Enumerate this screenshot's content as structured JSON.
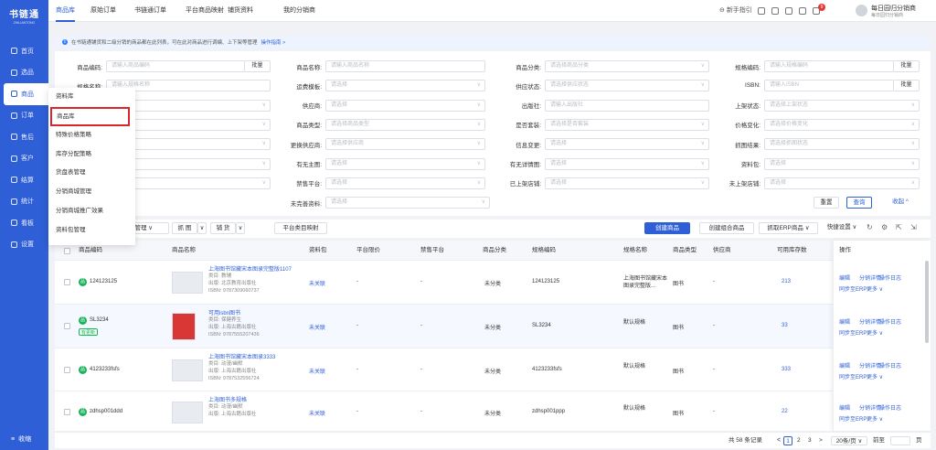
{
  "app": {
    "logo": "书链通",
    "logo_sub": "ZHILIANTONG"
  },
  "leftnav": [
    {
      "label": "首页",
      "icon": "home-icon"
    },
    {
      "label": "选品",
      "icon": "select-icon"
    },
    {
      "label": "商品",
      "icon": "goods-icon",
      "active": true
    },
    {
      "label": "订单",
      "icon": "order-icon"
    },
    {
      "label": "售后",
      "icon": "aftersale-icon"
    },
    {
      "label": "客户",
      "icon": "customer-icon"
    },
    {
      "label": "结算",
      "icon": "settle-icon"
    },
    {
      "label": "统计",
      "icon": "stats-icon"
    },
    {
      "label": "看板",
      "icon": "board-icon"
    },
    {
      "label": "设置",
      "icon": "settings-icon"
    }
  ],
  "leftnav_bottom": "收缩",
  "toptabs": [
    "商品库",
    "原始订单",
    "书链通订单",
    "平台商品映射",
    "铺货资料",
    "我的分销商"
  ],
  "topright": {
    "guide": "新手指引",
    "user": "每日园归分销商",
    "user_sub": "每日园归分销商",
    "notif_count": "9"
  },
  "notice": {
    "text": "在书链通铺货和二级分销的商品都在此列表，可在此对商品进行调编、上下架等管理",
    "link": "操作指南 >"
  },
  "filters": {
    "r1": [
      {
        "label": "商品编码:",
        "ph": "请输入商品编码",
        "btn": "批量"
      },
      {
        "label": "商品名称:",
        "ph": "请输入商品名称"
      },
      {
        "label": "商品分类:",
        "ph": "请选择商品分类",
        "dd": true
      },
      {
        "label": "规格编码:",
        "ph": "请输入规格编码",
        "btn": "批量"
      }
    ],
    "r2": [
      {
        "label": "规格名称:",
        "ph": "请输入规格名称"
      },
      {
        "label": "运费模板:",
        "ph": "请选择",
        "dd": true
      },
      {
        "label": "供应状态:",
        "ph": "请选择供应状态",
        "dd": true
      },
      {
        "label": "ISBN:",
        "ph": "请输入ISBN",
        "btn": "批量"
      }
    ],
    "r3": [
      {
        "label": "",
        "ph": "选择类型",
        "dd": true
      },
      {
        "label": "供应商:",
        "ph": "请选择",
        "dd": true
      },
      {
        "label": "出版社:",
        "ph": "请输入出版社"
      },
      {
        "label": "上架状态:",
        "ph": "请选择上架状态",
        "dd": true
      }
    ],
    "r4": [
      {
        "label": "",
        "ph": "选择标签",
        "dd": true
      },
      {
        "label": "商品类型:",
        "ph": "请选择商品类型",
        "dd": true
      },
      {
        "label": "是否套装:",
        "ph": "请选择是否套装",
        "dd": true
      },
      {
        "label": "价格变化:",
        "ph": "请选择价格变化",
        "dd": true
      }
    ],
    "r5": [
      {
        "label": "",
        "ph": "选择变化",
        "dd": true
      },
      {
        "label": "更换供应商:",
        "ph": "请选择供应商",
        "dd": true
      },
      {
        "label": "信息变更:",
        "ph": "请选择",
        "dd": true
      },
      {
        "label": "抓图结果:",
        "ph": "请选择抓图状态",
        "dd": true
      }
    ],
    "r6": [
      {
        "label": "",
        "ph": "",
        "dd": true
      },
      {
        "label": "有无主图:",
        "ph": "请选择",
        "dd": true
      },
      {
        "label": "有无详情图:",
        "ph": "请选择",
        "dd": true
      },
      {
        "label": "资料包:",
        "ph": "请选择",
        "dd": true
      }
    ],
    "r7": [
      {
        "label": "",
        "ph": "",
        "dd": true
      },
      {
        "label": "禁售平台:",
        "ph": "请选择",
        "dd": true
      },
      {
        "label": "已上架店铺:",
        "ph": "请选择",
        "dd": true
      },
      {
        "label": "未上架店铺:",
        "ph": "请选择",
        "dd": true
      }
    ],
    "r8": [
      {
        "label": "未完善资料:",
        "ph": "请选择",
        "dd": true
      }
    ],
    "reset": "重置",
    "query": "查询",
    "collapse": "收起 ^"
  },
  "dropdown": [
    "资料库",
    "商品库",
    "特殊价格策略",
    "库存分配策略",
    "货盘表管理",
    "分销商城管理",
    "分销商城推广效果",
    "资料包管理"
  ],
  "toolbar": {
    "left": [
      "库管理 ∨",
      "抓 图",
      "∨",
      "铺 货",
      "∨",
      "平台类目映射"
    ],
    "create": "创建商品",
    "create_combo": "创建组合商品",
    "erp": "抓取ERP商品 ∨",
    "quick": "快捷设置 ∨"
  },
  "table": {
    "headers": [
      "商品编码",
      "商品名称",
      "资料包",
      "平台限价",
      "禁售平台",
      "商品分类",
      "规格编码",
      "规格名称",
      "商品类型",
      "供应商",
      "可用库存数",
      "操作"
    ],
    "rows": [
      {
        "code": "124123125",
        "name": "上海图书馆藏宋本图录完整版1107",
        "cat": "类目: 教辅",
        "pub": "出版: 北京教育出版社",
        "isbn": "ISBN: 9787309060737",
        "pkg": "未关联",
        "limit": "-",
        "ban": "-",
        "cls": "未分类",
        "skucode": "124123125",
        "skuname": "上海图书馆藏宋本图录完整版...",
        "type": "图书",
        "supplier": "-",
        "stock": "213",
        "ops": [
          "编辑",
          "分销详情",
          "操作日志"
        ],
        "ops2": [
          "同步至ERP",
          "更多 ∨"
        ]
      },
      {
        "code": "SL3234",
        "badge": "有更新",
        "name": "可用isbn图书",
        "cat": "类目: 保健养生",
        "pub": "出版: 上海古籍出版社",
        "isbn": "ISBN: 9787555207436",
        "pkg": "未关联",
        "limit": "-",
        "ban": "-",
        "cls": "未分类",
        "skucode": "SL3234",
        "skuname": "默认规格",
        "type": "图书",
        "supplier": "-",
        "stock": "33",
        "ops": [
          "编辑",
          "分销详情",
          "操作日志"
        ],
        "ops2": [
          "同步至ERP",
          "更多 ∨"
        ]
      },
      {
        "code": "4123233fsfs",
        "name": "上海图书馆藏宋本图录3333",
        "cat": "类目: 动漫/幽默",
        "pub": "出版: 上海古籍出版社",
        "isbn": "ISBN: 9787532556724",
        "pkg": "未关联",
        "limit": "-",
        "ban": "-",
        "cls": "未分类",
        "skucode": "4123233fsfs",
        "skuname": "默认规格",
        "type": "图书",
        "supplier": "-",
        "stock": "333",
        "ops": [
          "编辑",
          "分销详情",
          "操作日志"
        ],
        "ops2": [
          "同步至ERP",
          "更多 ∨"
        ]
      },
      {
        "code": "zdhsp001ddd",
        "name": "上海图书多规格",
        "cat": "类目: 动漫/幽默",
        "pub": "出版: 上海古籍出版社",
        "isbn": "",
        "pkg": "未关联",
        "limit": "-",
        "ban": "-",
        "cls": "未分类",
        "skucode": "zdhsp001ppp",
        "skuname": "默认规格",
        "type": "图书",
        "supplier": "-",
        "stock": "22",
        "ops": [
          "编辑",
          "分销详情",
          "操作日志"
        ],
        "ops2": [
          "同步至ERP",
          "更多 ∨"
        ]
      }
    ]
  },
  "footer": {
    "total": "共 58 条记录",
    "pages": [
      "1",
      "2",
      "3"
    ],
    "next": ">",
    "size": "20条/页 ∨",
    "goto": "前至",
    "page_unit": "页"
  }
}
